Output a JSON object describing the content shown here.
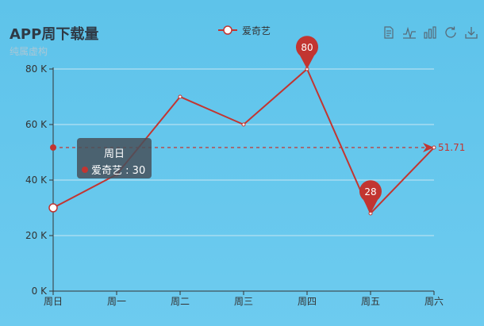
{
  "chart_data": {
    "type": "line",
    "title": "APP周下载量",
    "subtitle": "纯属虚构",
    "categories": [
      "周日",
      "周一",
      "周二",
      "周三",
      "周四",
      "周五",
      "周六"
    ],
    "y_tick_labels": [
      "0 K",
      "20 K",
      "40 K",
      "60 K",
      "80 K"
    ],
    "y_ticks": [
      0,
      20,
      40,
      60,
      80
    ],
    "ylim": [
      0,
      80
    ],
    "series": [
      {
        "name": "爱奇艺",
        "values": [
          30,
          42,
          70,
          60,
          80,
          28,
          51.71
        ],
        "color": "#c23531"
      }
    ],
    "mark_points": [
      {
        "label": "80",
        "category": "周四",
        "value": 80
      },
      {
        "label": "28",
        "category": "周五",
        "value": 28
      }
    ],
    "mark_line": {
      "type": "average",
      "value": 51.71,
      "label": "51.71"
    },
    "grid": true,
    "legend_position": "top-center"
  },
  "tooltip": {
    "title": "周日",
    "series_name": "爱奇艺",
    "value": "30"
  },
  "toolbox": {
    "icons": [
      "data-view-icon",
      "line-chart-icon",
      "bar-chart-icon",
      "restore-icon",
      "save-image-icon"
    ]
  },
  "colors": {
    "accent": "#c23531",
    "background": "#62c5ec",
    "grid": "#c8e6f3"
  }
}
